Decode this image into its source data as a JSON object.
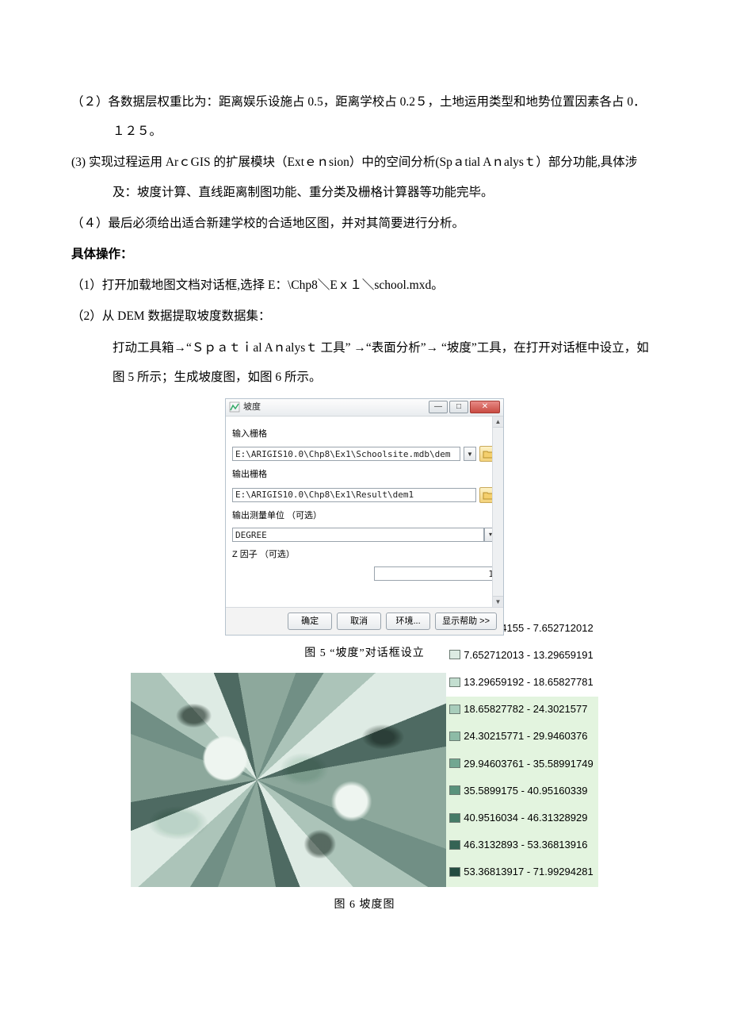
{
  "paragraphs": {
    "p1": "（２）各数据层权重比为：距离娱乐设施占 0.5，距离学校占 0.2５，土地运用类型和地势位置因素各占 0．１２５。",
    "p2": "(3)   实现过程运用 ArｃGIS 的扩展模块（Extｅｎsion）中的空间分析(Spａtial Aｎalysｔ）部分功能,具体涉及：坡度计算、直线距离制图功能、重分类及栅格计算器等功能完毕。",
    "p3": "（４）最后必须给出适合新建学校的合适地区图，并对其简要进行分析。",
    "heading": "具体操作：",
    "s1": "（1）打开加载地图文档对话框,选择 E：\\Chp8＼Eｘ１＼school.mxd。",
    "s2": "（2）从   DEM  数据提取坡度数据集：",
    "s2a": "打动工具箱→“Ｓｐａｔｉal Aｎalysｔ 工具”  →“表面分析”→ “坡度”工具，在打开对话框中设立，如图 5 所示；生成坡度图，如图 6 所示。"
  },
  "dialog": {
    "title": "坡度",
    "labels": {
      "input_raster": "输入栅格",
      "output_raster": "输出栅格",
      "output_unit": "输出测量单位 （可选）",
      "z_factor": "Z 因子 （可选）"
    },
    "values": {
      "input_path": "E:\\ARIGIS10.0\\Chp8\\Ex1\\Schoolsite.mdb\\dem",
      "output_path": "E:\\ARIGIS10.0\\Chp8\\Ex1\\Result\\dem1",
      "unit": "DEGREE",
      "z": "1"
    },
    "buttons": {
      "ok": "确定",
      "cancel": "取消",
      "env": "环境...",
      "help": "显示帮助 >>"
    }
  },
  "captions": {
    "fig5": "图 5   “坡度”对话框设立",
    "fig6": "图 6   坡度图"
  },
  "legend": [
    {
      "color": "#f3f8f4",
      "range": "0.033474155 - 7.652712012"
    },
    {
      "color": "#dcece3",
      "range": "7.652712013 - 13.29659191"
    },
    {
      "color": "#c3ded0",
      "range": "13.29659192 - 18.65827781"
    },
    {
      "color": "#a8cdbb",
      "range": "18.65827782 - 24.3021577"
    },
    {
      "color": "#8dbba6",
      "range": "24.30215771 - 29.9460376"
    },
    {
      "color": "#72a791",
      "range": "29.94603761 - 35.58991749"
    },
    {
      "color": "#5a927c",
      "range": "35.5899175 - 40.95160339"
    },
    {
      "color": "#457b67",
      "range": "40.9516034 - 46.31328929"
    },
    {
      "color": "#346354",
      "range": "46.3132893 - 53.36813916"
    },
    {
      "color": "#244c41",
      "range": "53.36813917 - 71.99294281"
    }
  ]
}
